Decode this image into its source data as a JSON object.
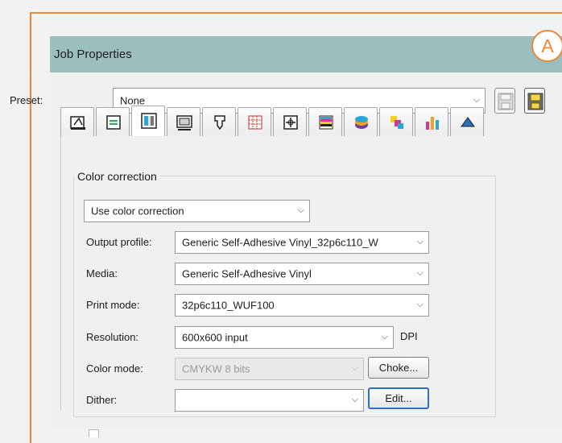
{
  "window": {
    "title": "Job Properties"
  },
  "callout": {
    "label": "A"
  },
  "preset": {
    "label": "Preset:",
    "value": "None"
  },
  "tabs": [
    {
      "icon": "printer-setup-icon"
    },
    {
      "icon": "job-settings-icon"
    },
    {
      "icon": "color-management-icon",
      "active": true
    },
    {
      "icon": "media-layout-icon"
    },
    {
      "icon": "nozzle-icon"
    },
    {
      "icon": "grid-tiling-icon"
    },
    {
      "icon": "crop-marks-icon"
    },
    {
      "icon": "color-bars-icon"
    },
    {
      "icon": "layers-icon"
    },
    {
      "icon": "spot-color-icon"
    },
    {
      "icon": "ink-levels-icon"
    },
    {
      "icon": "more-icon"
    }
  ],
  "color_correction": {
    "group_title": "Color correction",
    "mode": "Use color correction",
    "output_profile": {
      "label": "Output profile:",
      "value": "Generic Self-Adhesive Vinyl_32p6c110_W"
    },
    "media": {
      "label": "Media:",
      "value": "Generic Self-Adhesive Vinyl"
    },
    "print_mode": {
      "label": "Print mode:",
      "value": "32p6c110_WUF100"
    },
    "resolution": {
      "label": "Resolution:",
      "value": "600x600 input",
      "unit": "DPI"
    },
    "color_mode": {
      "label": "Color mode:",
      "value": "CMYKW 8 bits",
      "button": "Choke..."
    },
    "dither": {
      "label": "Dither:",
      "value": "",
      "button": "Edit..."
    }
  },
  "colors": {
    "accent": "#e8893a",
    "titlebar": "#9bbfbf",
    "focus": "#2e6fc4"
  }
}
